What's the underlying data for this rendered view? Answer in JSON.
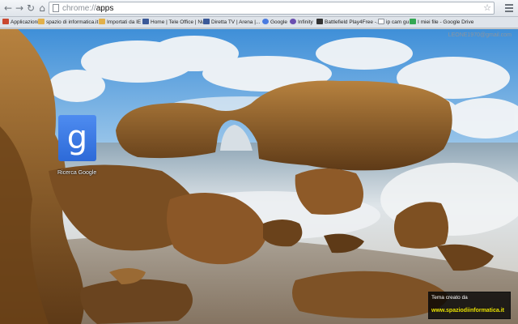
{
  "browser": {
    "back_glyph": "←",
    "forward_glyph": "→",
    "reload_glyph": "↻",
    "home_glyph": "⌂",
    "url_scheme": "chrome://",
    "url_host": "apps",
    "star_glyph": "☆"
  },
  "bookmarks": [
    {
      "label": "Applicazioni",
      "icon": "apps-grid-icon"
    },
    {
      "label": "spazio di informatica.it",
      "icon": "folder-icon"
    },
    {
      "label": "Importati da IE",
      "icon": "folder-icon"
    },
    {
      "label": "Home | Tele Office | Nu...",
      "icon": "page-icon"
    },
    {
      "label": "Diretta TV | Arena |...",
      "icon": "tv-icon"
    },
    {
      "label": "Google",
      "icon": "google-icon"
    },
    {
      "label": "Infinity",
      "icon": "infinity-icon"
    },
    {
      "label": "Battlefield Play4Free -...",
      "icon": "battlefield-icon"
    },
    {
      "label": "ip cam gu",
      "icon": "page-icon"
    },
    {
      "label": "I miei file - Google Drive",
      "icon": "drive-icon"
    }
  ],
  "content": {
    "user_label": "LEONE1970@gmail.com",
    "apps": [
      {
        "name": "Ricerca Google",
        "icon": "google-search-icon",
        "glyph": "g"
      }
    ],
    "credit": {
      "line1": "Tema creato da",
      "line2": "www.spaziodiinformatica.it"
    }
  },
  "colors": {
    "sky": "#4f9ee0",
    "rock": "#8a5a25",
    "surf": "#e8ecef",
    "app_tile": "#3c7be6",
    "credit_link": "#e8e000"
  }
}
